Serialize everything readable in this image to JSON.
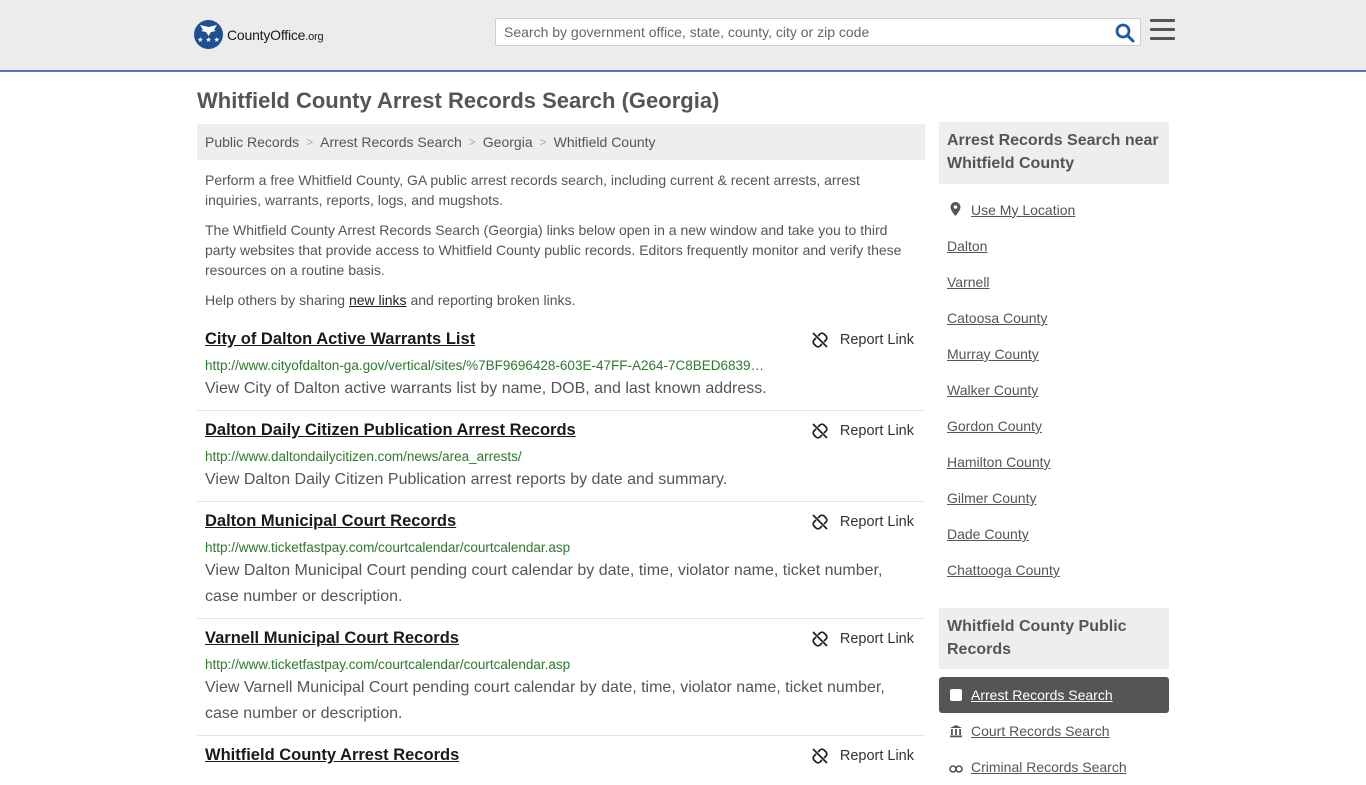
{
  "header": {
    "logo_main": "CountyOffice",
    "logo_suffix": ".org",
    "logo_stars": "★ ★ ★",
    "search_placeholder": "Search by government office, state, county, city or zip code"
  },
  "page_title": "Whitfield County Arrest Records Search (Georgia)",
  "breadcrumb": [
    "Public Records",
    "Arrest Records Search",
    "Georgia",
    "Whitfield County"
  ],
  "breadcrumb_separator": ">",
  "intro": {
    "p1": "Perform a free Whitfield County, GA public arrest records search, including current & recent arrests, arrest inquiries, warrants, reports, logs, and mugshots.",
    "p2": "The Whitfield County Arrest Records Search (Georgia) links below open in a new window and take you to third party websites that provide access to Whitfield County public records. Editors frequently monitor and verify these resources on a routine basis.",
    "p3_before": "Help others by sharing ",
    "p3_link": "new links",
    "p3_after": " and reporting broken links."
  },
  "report_label": "Report Link",
  "results": [
    {
      "title": "City of Dalton Active Warrants List",
      "url": "http://www.cityofdalton-ga.gov/vertical/sites/%7BF9696428-603E-47FF-A264-7C8BED6839…",
      "desc": "View City of Dalton active warrants list by name, DOB, and last known address."
    },
    {
      "title": "Dalton Daily Citizen Publication Arrest Records",
      "url": "http://www.daltondailycitizen.com/news/area_arrests/",
      "desc": "View Dalton Daily Citizen Publication arrest reports by date and summary."
    },
    {
      "title": "Dalton Municipal Court Records",
      "url": "http://www.ticketfastpay.com/courtcalendar/courtcalendar.asp",
      "desc": "View Dalton Municipal Court pending court calendar by date, time, violator name, ticket number, case number or description."
    },
    {
      "title": "Varnell Municipal Court Records",
      "url": "http://www.ticketfastpay.com/courtcalendar/courtcalendar.asp",
      "desc": "View Varnell Municipal Court pending court calendar by date, time, violator name, ticket number, case number or description."
    },
    {
      "title": "Whitfield County Arrest Records",
      "url": "",
      "desc": ""
    }
  ],
  "sidebar": {
    "nearby_heading": "Arrest Records Search near Whitfield County",
    "use_location": "Use My Location",
    "nearby": [
      "Dalton",
      "Varnell",
      "Catoosa County",
      "Murray County",
      "Walker County",
      "Gordon County",
      "Hamilton County",
      "Gilmer County",
      "Dade County",
      "Chattooga County"
    ],
    "public_heading": "Whitfield County Public Records",
    "public_records": [
      {
        "label": "Arrest Records Search",
        "icon": "checkbox-icon",
        "active": true
      },
      {
        "label": "Court Records Search",
        "icon": "courthouse-icon",
        "active": false
      },
      {
        "label": "Criminal Records Search",
        "icon": "handcuffs-icon",
        "active": false
      }
    ]
  },
  "colors": {
    "accent": "#4a7ab5",
    "url_green": "#2c7a2c",
    "header_bg": "#ececec",
    "active_bg": "#555555"
  }
}
